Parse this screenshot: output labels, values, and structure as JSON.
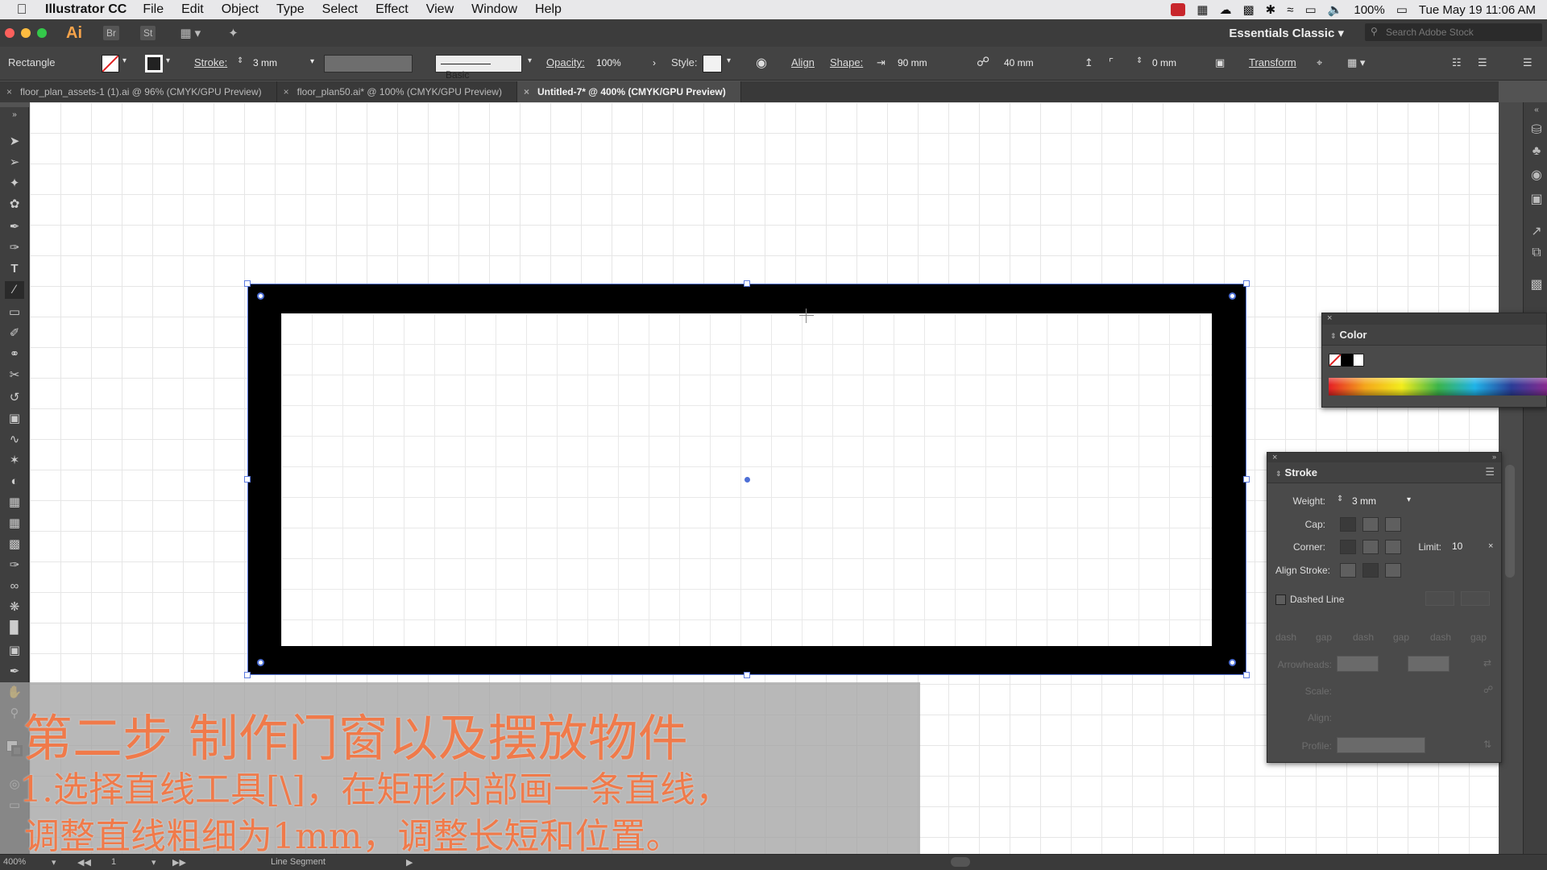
{
  "menubar": {
    "app_name": "Illustrator CC",
    "items": [
      "File",
      "Edit",
      "Object",
      "Type",
      "Select",
      "Effect",
      "View",
      "Window",
      "Help"
    ],
    "battery": "100%",
    "datetime": "Tue May 19  11:06 AM"
  },
  "titlebar": {
    "logo": "Ai",
    "bridge": "Br",
    "stock": "St",
    "workspace": "Essentials Classic",
    "search_placeholder": "Search Adobe Stock"
  },
  "controlbar": {
    "selection_type": "Rectangle",
    "stroke_label": "Stroke:",
    "stroke_value": "3 mm",
    "brush_label": "Basic",
    "opacity_label": "Opacity:",
    "opacity_value": "100%",
    "style_label": "Style:",
    "align_label": "Align",
    "shape_label": "Shape:",
    "width_value": "90 mm",
    "height_value": "40 mm",
    "corner_value": "0 mm",
    "transform_label": "Transform"
  },
  "tabs": [
    {
      "label": "floor_plan_assets-1 (1).ai @ 96% (CMYK/GPU Preview)",
      "active": false
    },
    {
      "label": "floor_plan50.ai* @ 100% (CMYK/GPU Preview)",
      "active": false
    },
    {
      "label": "Untitled-7* @ 400% (CMYK/GPU Preview)",
      "active": true
    }
  ],
  "color_panel": {
    "title": "Color"
  },
  "stroke_panel": {
    "title": "Stroke",
    "weight_label": "Weight:",
    "weight_value": "3 mm",
    "cap_label": "Cap:",
    "corner_label": "Corner:",
    "limit_label": "Limit:",
    "limit_value": "10",
    "align_stroke_label": "Align Stroke:",
    "dashed_line_label": "Dashed Line",
    "dash_labels": [
      "dash",
      "gap",
      "dash",
      "gap",
      "dash",
      "gap"
    ],
    "arrowheads_label": "Arrowheads:",
    "scale_label": "Scale:",
    "align_label": "Align:",
    "profile_label": "Profile:"
  },
  "subtitle": {
    "line1": "第二步  制作门窗以及摆放物件",
    "line2": "1.选择直线工具[\\]，在矩形内部画一条直线，",
    "line3": "调整直线粗细为1mm，调整长短和位置。"
  },
  "statusbar": {
    "zoom": "400%",
    "artboard": "1",
    "tool_name": "Line Segment"
  },
  "colors": {
    "accent_selection": "#5e7ce0",
    "subtitle_text": "#f07a4a",
    "ai_logo": "#f7a34a"
  }
}
